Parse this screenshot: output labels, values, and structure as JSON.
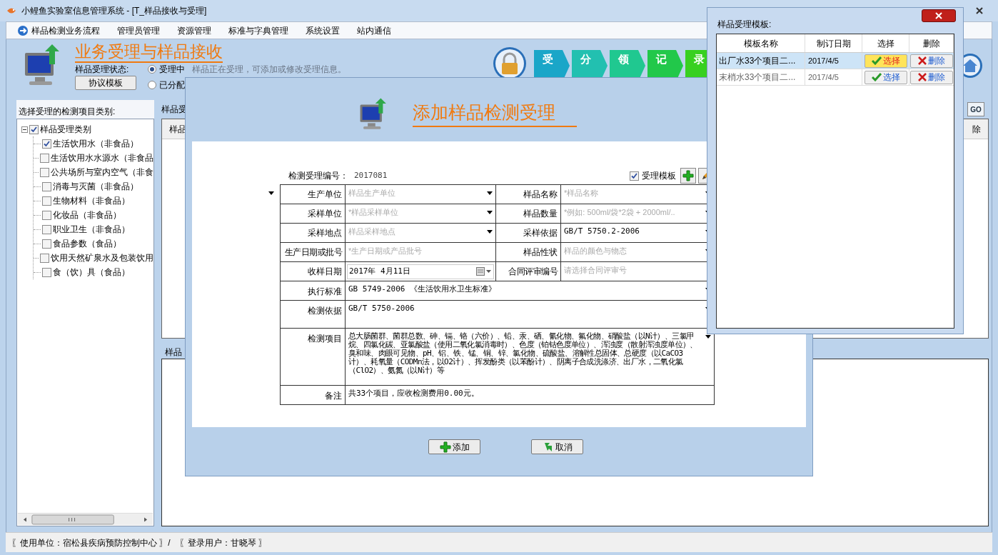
{
  "window": {
    "title": "小鲤鱼实验室信息管理系统 - [T_样品接收与受理]"
  },
  "menu": [
    "样品检测业务流程",
    "管理员管理",
    "资源管理",
    "标准与字典管理",
    "系统设置",
    "站内通信"
  ],
  "header": {
    "title": "业务受理与样品接收",
    "status_label": "样品受理状态:",
    "status_options": [
      {
        "label": "受理中",
        "selected": true
      },
      {
        "label": "已分配",
        "selected": false
      }
    ],
    "hint": "样品正在受理，可添加或修改受理信息。",
    "template_button": "协议模板"
  },
  "workflow_steps": [
    {
      "label": "受",
      "color": "#1aa6c8"
    },
    {
      "label": "分",
      "color": "#22c0b0"
    },
    {
      "label": "领",
      "color": "#20c890"
    },
    {
      "label": "记",
      "color": "#22c84a"
    },
    {
      "label": "录",
      "color": "#38d020"
    }
  ],
  "category_panel": {
    "label": "选择受理的检测项目类别:",
    "tree": {
      "label": "样品受理类别",
      "checked": true,
      "expanded": true,
      "children": [
        {
          "label": "生活饮用水（非食品）",
          "checked": true
        },
        {
          "label": "生活饮用水水源水（非食品",
          "checked": false
        },
        {
          "label": "公共场所与室内空气（非食",
          "checked": false
        },
        {
          "label": "消毒与灭菌（非食品）",
          "checked": false
        },
        {
          "label": "生物材料（非食品）",
          "checked": false
        },
        {
          "label": "化妆品（非食品）",
          "checked": false
        },
        {
          "label": "职业卫生（非食品）",
          "checked": false
        },
        {
          "label": "食品参数（食品）",
          "checked": false
        },
        {
          "label": "饮用天然矿泉水及包装饮用",
          "checked": false
        },
        {
          "label": "食（饮）具（食品）",
          "checked": false
        }
      ]
    }
  },
  "sample_panel": {
    "label": "样品受",
    "columns": [
      "样品",
      "除"
    ],
    "go_button": "GO"
  },
  "record_panel": {
    "label": "样品"
  },
  "dialog": {
    "title": "添加样品检测受理",
    "number_label": "检测受理编号：",
    "number": "2017081",
    "template_checkbox": {
      "label": "受理模板",
      "checked": true
    },
    "rows": [
      {
        "cells": [
          {
            "label": "生产单位",
            "kind": "dropdown",
            "placeholder": "样品生产单位"
          },
          {
            "label": "样品名称",
            "kind": "dropdown",
            "placeholder": "*样品名称"
          }
        ]
      },
      {
        "cells": [
          {
            "label": "采样单位",
            "kind": "dropdown",
            "placeholder": "*样品采样单位"
          },
          {
            "label": "样品数量",
            "kind": "dropdown",
            "placeholder": "*例如: 500ml/袋*2袋 + 2000ml/.."
          }
        ]
      },
      {
        "cells": [
          {
            "label": "采样地点",
            "kind": "dropdown",
            "placeholder": "样品采样地点"
          },
          {
            "label": "采样依据",
            "kind": "dropdown",
            "value": "GB/T 5750.2-2006"
          }
        ]
      },
      {
        "cells": [
          {
            "label": "生产日期或批号",
            "kind": "text",
            "placeholder": "*生产日期或产品批号"
          },
          {
            "label": "样品性状",
            "kind": "dropdown",
            "placeholder": "样品的颜色与物态"
          }
        ]
      },
      {
        "cells": [
          {
            "label": "收样日期",
            "kind": "date",
            "value": "2017年 4月11日"
          },
          {
            "label": "合同评审编号",
            "kind": "text",
            "placeholder": "请选择合同评审号"
          }
        ]
      },
      {
        "cells": [
          {
            "label": "执行标准",
            "kind": "dropdown",
            "value": "GB 5749-2006 《生活饮用水卫生标准》"
          }
        ]
      },
      {
        "cells": [
          {
            "label": "检测依据",
            "kind": "dropdown",
            "value": "GB/T 5750-2006"
          }
        ]
      },
      {
        "cells": [
          {
            "label": "检测项目",
            "kind": "dropdown",
            "value": "总大肠菌群、菌群总数、砷、镉、铬（六价）、铅、汞、硒、氰化物、氟化物、硝酸盐（以N计）、三氯甲烷、四氯化碳、亚氯酸盐（使用二氧化氯消毒时）、色度（铂钴色度单位）、浑浊度（散射浑浊度单位）、臭和味、肉眼可见物、pH、铝、铁、锰、铜、锌、氯化物、硫酸盐、溶解性总固体、总硬度（以CaCO3计）、耗氧量（CODMn法，以O2计）、挥发酚类（以苯酚计）、阴离子合成洗涤济、出厂水，二氧化氯（ClO2）、氨氮（以N计）等"
          }
        ]
      },
      {
        "cells": [
          {
            "label": "备注",
            "kind": "text",
            "value": "共33个项目，应收检测费用0.00元。"
          }
        ]
      }
    ],
    "buttons": [
      {
        "label": "添加",
        "kind": "add"
      },
      {
        "label": "取消",
        "kind": "cancel"
      }
    ]
  },
  "template_popup": {
    "title": "样品受理模板:",
    "columns": [
      "模板名称",
      "制订日期",
      "选择",
      "删除"
    ],
    "rows": [
      {
        "name": "出厂水33个项目二...",
        "date": "2017/4/5",
        "select": "选择",
        "delete": "删除",
        "selected": true
      },
      {
        "name": "末梢水33个项目二...",
        "date": "2017/4/5",
        "select": "选择",
        "delete": "删除",
        "selected": false
      }
    ]
  },
  "status_bar": [
    "〖使用单位：宿松县疾病预防控制中心 〗/",
    "〖登录用户：甘晓琴 〗"
  ]
}
